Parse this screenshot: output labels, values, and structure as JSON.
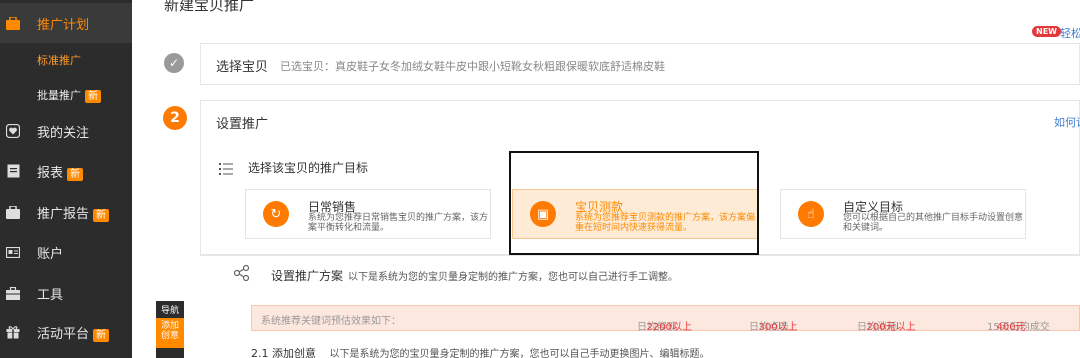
{
  "sidebar": {
    "items": [
      {
        "label": "推广计划",
        "icon": "briefcase-icon",
        "active": true
      },
      {
        "label": "我的关注",
        "icon": "heart-icon"
      },
      {
        "label": "报表",
        "icon": "report-icon",
        "badge": "新"
      },
      {
        "label": "推广报告",
        "icon": "briefcase-icon",
        "badge": "新"
      },
      {
        "label": "账户",
        "icon": "id-card-icon"
      },
      {
        "label": "工具",
        "icon": "toolbox-icon"
      },
      {
        "label": "活动平台",
        "icon": "gift-icon",
        "badge": "新"
      }
    ],
    "subitems": [
      {
        "label": "标准推广",
        "active": true
      },
      {
        "label": "批量推广",
        "badge": "新"
      }
    ]
  },
  "page": {
    "title": "新建宝贝推广",
    "new_badge": "NEW",
    "new_link": "轻松"
  },
  "step1": {
    "label": "选择宝贝",
    "selected_prefix": "已选宝贝：",
    "selected_item": "真皮鞋子女冬加绒女鞋牛皮中跟小短靴女秋粗跟保暖软底舒适棉皮鞋"
  },
  "step2": {
    "number": "2",
    "label": "设置推广",
    "howto_link": "如何设"
  },
  "goal": {
    "title": "选择该宝贝的推广目标",
    "cards": [
      {
        "name": "日常销售",
        "desc": "系统为您推荐日常销售宝贝的推广方案，该方案平衡转化和流量。",
        "icon": "refresh-icon",
        "glyph": "↻",
        "selected": false
      },
      {
        "name": "宝贝测款",
        "desc": "系统为您推荐宝贝测款的推广方案，该方案偏重在短时间内快速获得流量。",
        "icon": "bag-icon",
        "glyph": "▣",
        "selected": true
      },
      {
        "name": "自定义目标",
        "desc": "您可以根据自己的其他推广目标手动设置创意和关键词。",
        "icon": "hand-pointer-icon",
        "glyph": "☝",
        "selected": false
      }
    ]
  },
  "plan": {
    "title": "设置推广方案",
    "desc": "以下是系统为您的宝贝量身定制的推广方案，您也可以自己进行手工调整。"
  },
  "keyword_bar": {
    "label": "系统推荐关键词预估效果如下：",
    "stats": [
      {
        "label": "日均展现",
        "value": "2200以上"
      },
      {
        "label": "日均点击",
        "value": "300以上"
      },
      {
        "label": "日均消耗",
        "value": "200元以上"
      },
      {
        "label": "15天日均成交",
        "value": "400元"
      }
    ]
  },
  "creative": {
    "label": "2.1 添加创意",
    "desc": "以下是系统为您的宝贝量身定制的推广方案，您也可以自己手动更换图片、编辑标题。"
  },
  "nav_float": {
    "head": "导航",
    "body_line1": "添加",
    "body_line2": "创意"
  }
}
